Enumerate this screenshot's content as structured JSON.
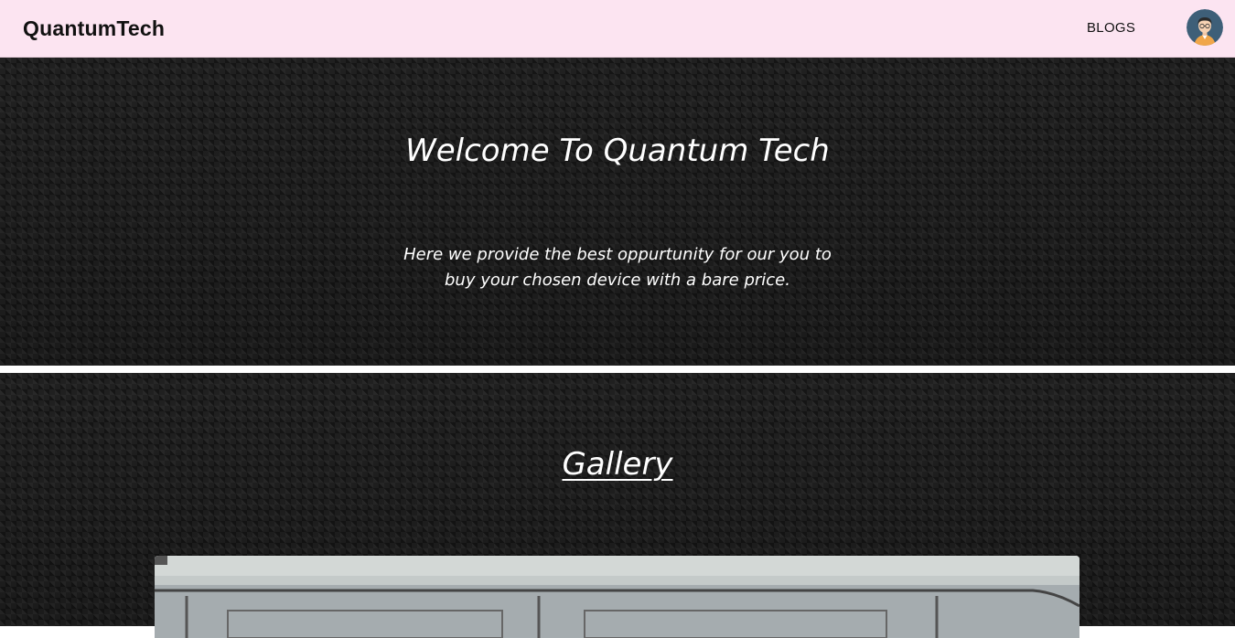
{
  "navbar": {
    "brand": "QuantumTech",
    "links": [
      {
        "label": "BLOGS"
      }
    ],
    "avatar_icon": "user-avatar-icon",
    "background": "#fce4f1"
  },
  "hero": {
    "title": "Welcome To Quantum Tech",
    "description": "Here we provide the best oppurtunity for our you to buy your chosen device with a bare price."
  },
  "gallery": {
    "title": "Gallery"
  },
  "colors": {
    "page_background": "#1c1c1c",
    "text": "#ffffff",
    "divider": "#ffffff"
  }
}
